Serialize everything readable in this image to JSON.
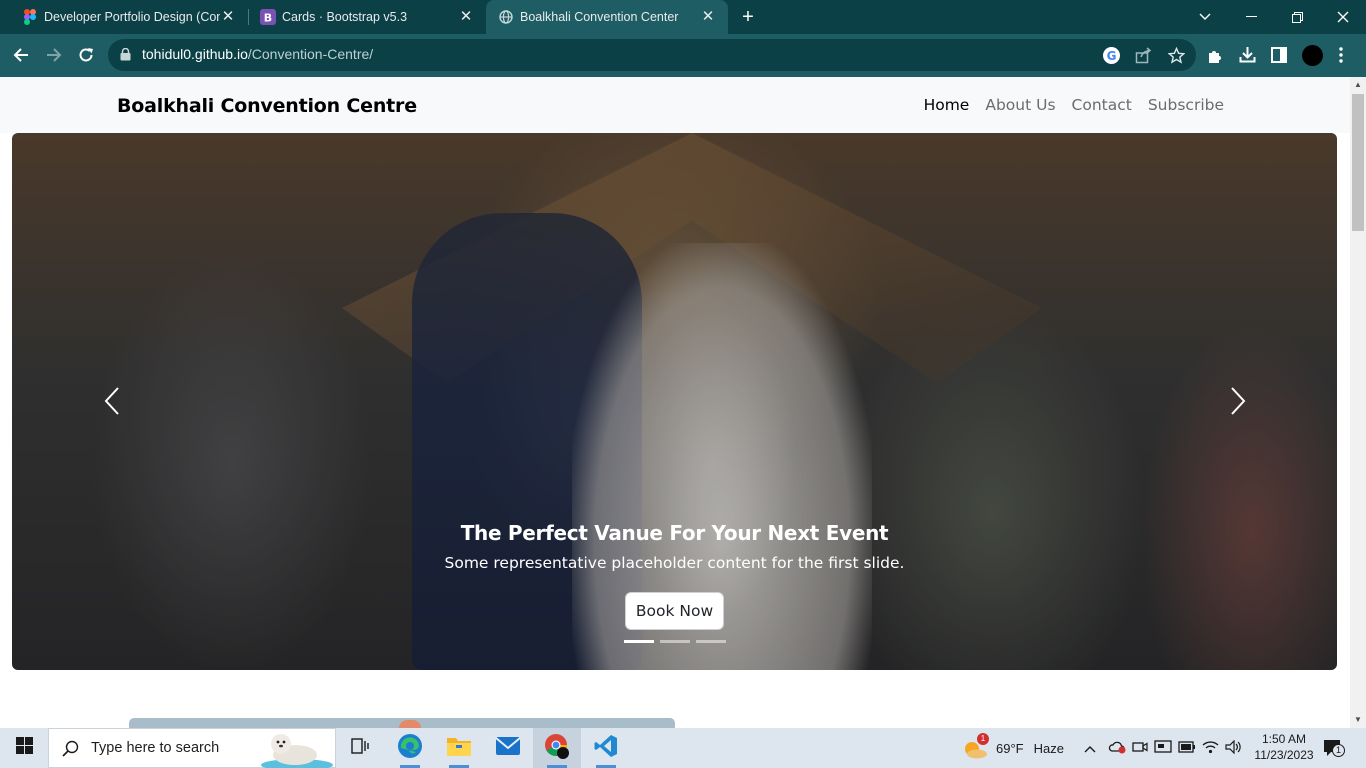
{
  "browser": {
    "tabs": [
      {
        "title": "Developer Portfolio Design (Con",
        "icon": "figma-icon",
        "active": false
      },
      {
        "title": "Cards · Bootstrap v5.3",
        "icon": "bootstrap-icon",
        "active": false
      },
      {
        "title": "Boalkhali Convention Center",
        "icon": "globe-icon",
        "active": true
      }
    ],
    "url_host": "tohidul0.github.io",
    "url_path": "/Convention-Centre/"
  },
  "site": {
    "brand": "Boalkhali Convention Centre",
    "nav": [
      {
        "label": "Home",
        "active": true
      },
      {
        "label": "About Us",
        "active": false
      },
      {
        "label": "Contact",
        "active": false
      },
      {
        "label": "Subscribe",
        "active": false
      }
    ]
  },
  "hero": {
    "title": "The Perfect Vanue For Your Next Event",
    "subtitle": "Some representative placeholder content for the first slide.",
    "button": "Book Now",
    "slides_total": 3,
    "active_slide": 1
  },
  "taskbar": {
    "search_placeholder": "Type here to search",
    "weather_temp": "69°F",
    "weather_text": "Haze",
    "weather_badge": "1",
    "time": "1:50 AM",
    "date": "11/23/2023",
    "notif_count": "1"
  }
}
